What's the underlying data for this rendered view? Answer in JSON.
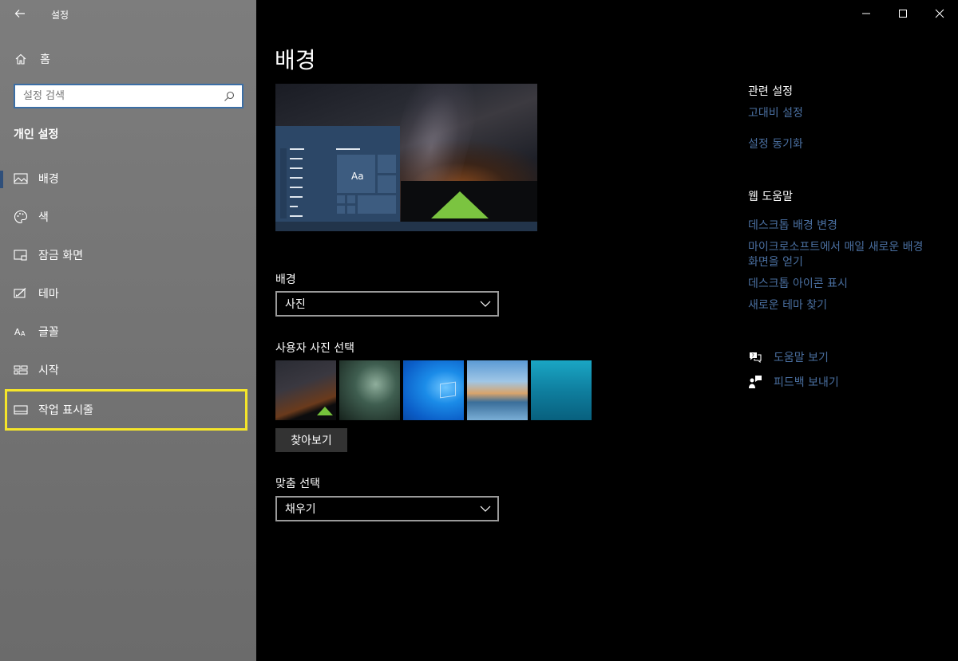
{
  "window": {
    "title": "설정"
  },
  "sidebar": {
    "home_label": "홈",
    "search_placeholder": "설정 검색",
    "section_title": "개인 설정",
    "items": [
      {
        "label": "배경",
        "icon": "picture-icon"
      },
      {
        "label": "색",
        "icon": "palette-icon"
      },
      {
        "label": "잠금 화면",
        "icon": "lock-screen-icon"
      },
      {
        "label": "테마",
        "icon": "theme-icon"
      },
      {
        "label": "글꼴",
        "icon": "font-icon"
      },
      {
        "label": "시작",
        "icon": "start-icon"
      },
      {
        "label": "작업 표시줄",
        "icon": "taskbar-icon"
      }
    ],
    "active_index": 0,
    "highlight_index": 6,
    "highlight_color": "#f5e52a"
  },
  "main": {
    "page_title": "배경",
    "preview_text": "Aa",
    "background_label": "배경",
    "background_value": "사진",
    "choose_picture_label": "사용자 사진 선택",
    "browse_label": "찾아보기",
    "fit_label": "맞춤 선택",
    "fit_value": "채우기"
  },
  "related": {
    "title": "관련 설정",
    "links": [
      "고대비 설정",
      "설정 동기화"
    ]
  },
  "web_help": {
    "title": "웹 도움말",
    "links": [
      "데스크톱 배경 변경",
      "마이크로소프트에서 매일 새로운 배경",
      "화면을 얻기",
      "데스크톱 아이콘 표시",
      "새로운 테마 찾기"
    ]
  },
  "support": {
    "get_help": "도움말 보기",
    "feedback": "피드백 보내기"
  },
  "colors": {
    "link": "#4a6fa0",
    "accent": "#2f4f7a"
  }
}
